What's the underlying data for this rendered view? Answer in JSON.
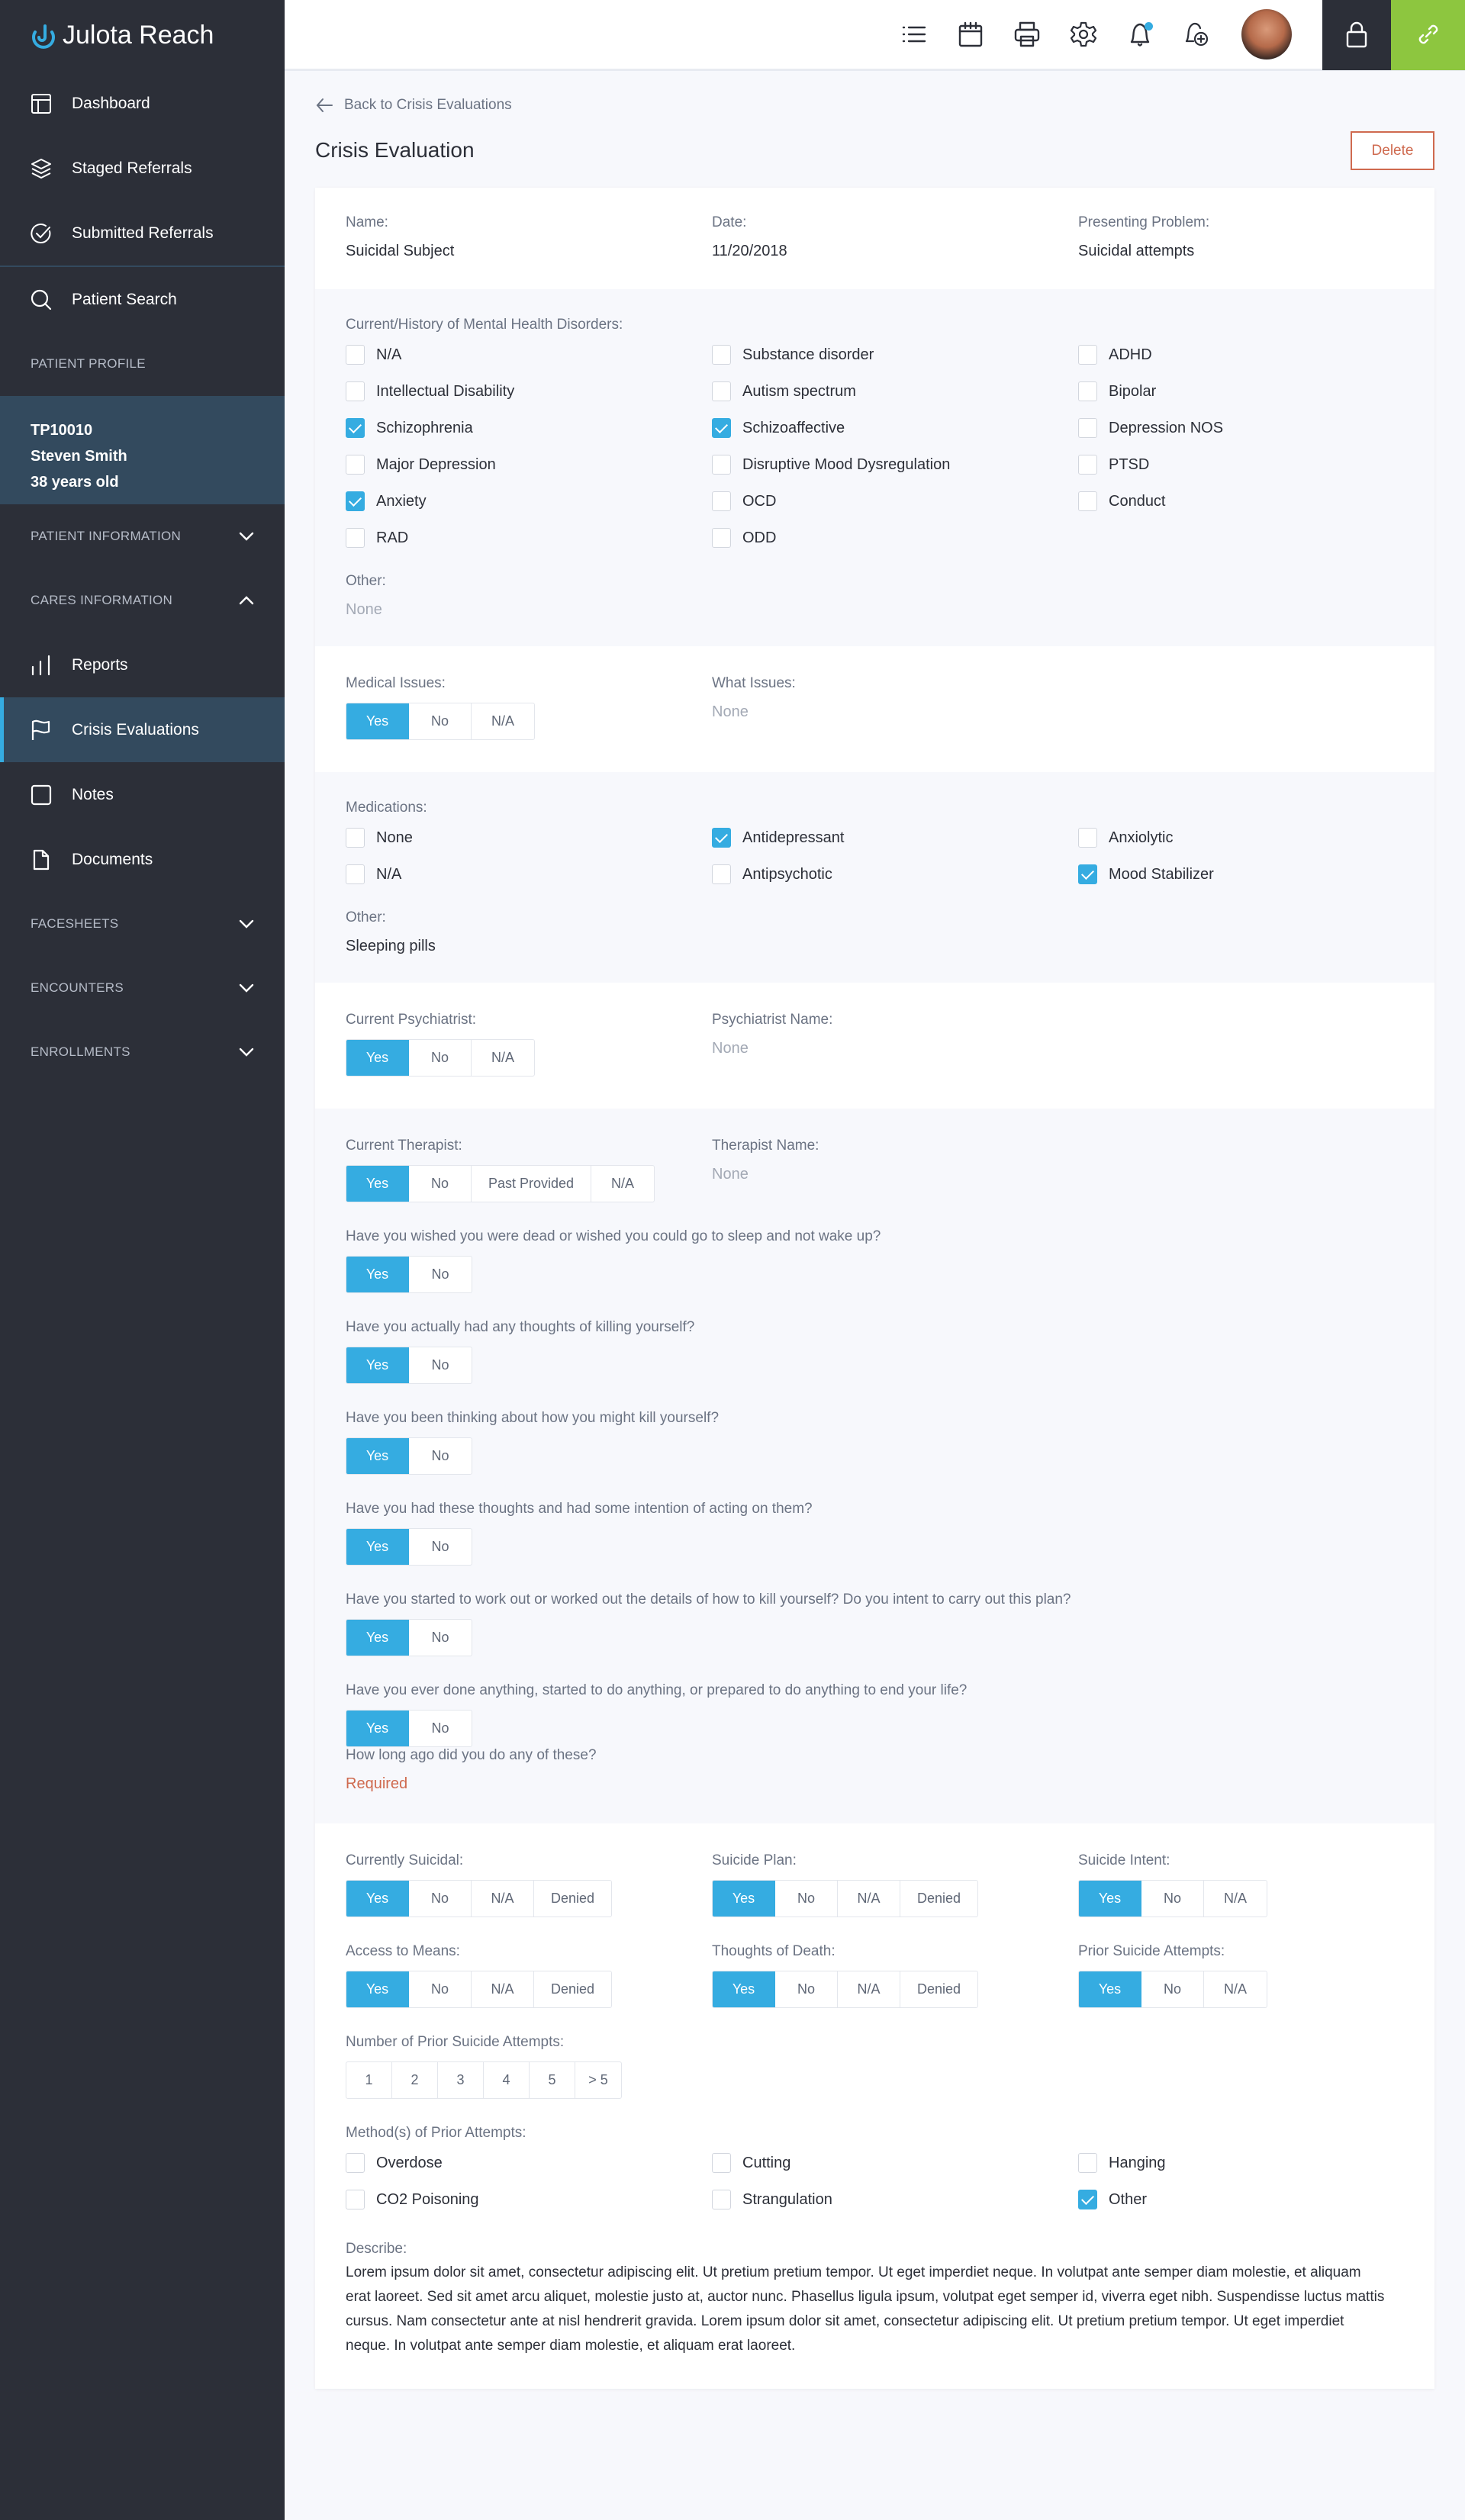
{
  "app": {
    "name": "Julota Reach"
  },
  "sidebar": {
    "nav": [
      {
        "label": "Dashboard",
        "icon": "dashboard-icon"
      },
      {
        "label": "Staged Referrals",
        "icon": "layers-icon"
      },
      {
        "label": "Submitted Referrals",
        "icon": "check-circle-icon"
      },
      {
        "label": "Patient Search",
        "icon": "search-icon"
      }
    ],
    "patient_profile_heading": "PATIENT PROFILE",
    "patient": {
      "id": "TP10010",
      "name": "Steven Smith",
      "age": "38 years old"
    },
    "patient_information": "PATIENT INFORMATION",
    "cares_information": "CARES INFORMATION",
    "cares_items": [
      {
        "label": "Reports",
        "icon": "bar-chart-icon",
        "active": false
      },
      {
        "label": "Crisis Evaluations",
        "icon": "flag-icon",
        "active": true
      },
      {
        "label": "Notes",
        "icon": "square-icon",
        "active": false
      },
      {
        "label": "Documents",
        "icon": "file-icon",
        "active": false
      }
    ],
    "facesheets": "FACESHEETS",
    "encounters": "ENCOUNTERS",
    "enrollments": "ENROLLMENTS"
  },
  "topbar": {
    "icons": [
      "list-icon",
      "calendar-icon",
      "printer-icon",
      "gear-icon",
      "bell-icon",
      "bell-plus-icon"
    ],
    "has_notification": true
  },
  "page": {
    "back_label": "Back to Crisis Evaluations",
    "title": "Crisis Evaluation",
    "delete_label": "Delete"
  },
  "summary": {
    "name_label": "Name:",
    "name": "Suicidal Subject",
    "date_label": "Date:",
    "date": "11/20/2018",
    "problem_label": "Presenting Problem:",
    "problem": "Suicidal attempts"
  },
  "disorders": {
    "label": "Current/History of Mental Health Disorders:",
    "columns": [
      [
        {
          "label": "N/A",
          "checked": false
        },
        {
          "label": "Intellectual Disability",
          "checked": false
        },
        {
          "label": "Schizophrenia",
          "checked": true
        },
        {
          "label": "Major Depression",
          "checked": false
        },
        {
          "label": "Anxiety",
          "checked": true
        },
        {
          "label": "RAD",
          "checked": false
        }
      ],
      [
        {
          "label": "Substance disorder",
          "checked": false
        },
        {
          "label": "Autism spectrum",
          "checked": false
        },
        {
          "label": "Schizoaffective",
          "checked": true
        },
        {
          "label": "Disruptive Mood Dysregulation",
          "checked": false
        },
        {
          "label": "OCD",
          "checked": false
        },
        {
          "label": "ODD",
          "checked": false
        }
      ],
      [
        {
          "label": "ADHD",
          "checked": false
        },
        {
          "label": "Bipolar",
          "checked": false
        },
        {
          "label": "Depression NOS",
          "checked": false
        },
        {
          "label": "PTSD",
          "checked": false
        },
        {
          "label": "Conduct",
          "checked": false
        }
      ]
    ],
    "other_label": "Other:",
    "other_value": "None"
  },
  "medical": {
    "label": "Medical Issues:",
    "options": [
      "Yes",
      "No",
      "N/A"
    ],
    "selected": "Yes",
    "what_label": "What Issues:",
    "what_value": "None"
  },
  "medications": {
    "label": "Medications:",
    "columns": [
      [
        {
          "label": "None",
          "checked": false
        },
        {
          "label": "N/A",
          "checked": false
        }
      ],
      [
        {
          "label": "Antidepressant",
          "checked": true
        },
        {
          "label": "Antipsychotic",
          "checked": false
        }
      ],
      [
        {
          "label": "Anxiolytic",
          "checked": false
        },
        {
          "label": "Mood Stabilizer",
          "checked": true
        }
      ]
    ],
    "other_label": "Other:",
    "other_value": "Sleeping pills"
  },
  "psychiatrist": {
    "label": "Current Psychiatrist:",
    "options": [
      "Yes",
      "No",
      "N/A"
    ],
    "selected": "Yes",
    "name_label": "Psychiatrist Name:",
    "name_value": "None"
  },
  "therapist": {
    "label": "Current Therapist:",
    "options": [
      "Yes",
      "No",
      "Past Provided",
      "N/A"
    ],
    "selected": "Yes",
    "name_label": "Therapist Name:",
    "name_value": "None"
  },
  "questions": [
    {
      "text": "Have you wished you were dead or wished you could go to sleep and not wake up?",
      "options": [
        "Yes",
        "No"
      ],
      "selected": "Yes"
    },
    {
      "text": "Have you actually had any thoughts of killing yourself?",
      "options": [
        "Yes",
        "No"
      ],
      "selected": "Yes"
    },
    {
      "text": "Have you been thinking about how you might kill yourself?",
      "options": [
        "Yes",
        "No"
      ],
      "selected": "Yes"
    },
    {
      "text": "Have you had these thoughts and had some intention of acting on them?",
      "options": [
        "Yes",
        "No"
      ],
      "selected": "Yes"
    },
    {
      "text": "Have you started to work out or worked out the details of how to kill yourself? Do you intent to carry out this plan?",
      "options": [
        "Yes",
        "No"
      ],
      "selected": "Yes"
    },
    {
      "text": "Have you ever done anything, started to do anything, or prepared to do anything to end your life?",
      "options": [
        "Yes",
        "No"
      ],
      "selected": "Yes"
    }
  ],
  "how_long": {
    "label": "How long ago did you do any of these?",
    "value": "Required"
  },
  "risk": {
    "row1": [
      {
        "label": "Currently Suicidal:",
        "options": [
          "Yes",
          "No",
          "N/A",
          "Denied"
        ],
        "selected": "Yes"
      },
      {
        "label": "Suicide Plan:",
        "options": [
          "Yes",
          "No",
          "N/A",
          "Denied"
        ],
        "selected": "Yes"
      },
      {
        "label": "Suicide Intent:",
        "options": [
          "Yes",
          "No",
          "N/A"
        ],
        "selected": "Yes"
      }
    ],
    "row2": [
      {
        "label": "Access to Means:",
        "options": [
          "Yes",
          "No",
          "N/A",
          "Denied"
        ],
        "selected": "Yes"
      },
      {
        "label": "Thoughts of Death:",
        "options": [
          "Yes",
          "No",
          "N/A",
          "Denied"
        ],
        "selected": "Yes"
      },
      {
        "label": "Prior Suicide Attempts:",
        "options": [
          "Yes",
          "No",
          "N/A"
        ],
        "selected": "Yes"
      }
    ],
    "num_attempts_label": "Number of Prior Suicide Attempts:",
    "num_attempts_options": [
      "1",
      "2",
      "3",
      "4",
      "5",
      "> 5"
    ],
    "num_attempts_selected": null,
    "methods_label": "Method(s) of Prior Attempts:",
    "methods_columns": [
      [
        {
          "label": "Overdose",
          "checked": false
        },
        {
          "label": "CO2 Poisoning",
          "checked": false
        }
      ],
      [
        {
          "label": "Cutting",
          "checked": false
        },
        {
          "label": "Strangulation",
          "checked": false
        }
      ],
      [
        {
          "label": "Hanging",
          "checked": false
        },
        {
          "label": "Other",
          "checked": true
        }
      ]
    ],
    "describe_label": "Describe:",
    "describe_text": "Lorem ipsum dolor sit amet, consectetur adipiscing elit. Ut pretium pretium tempor. Ut eget imperdiet neque. In volutpat ante semper diam molestie, et aliquam erat laoreet. Sed sit amet arcu aliquet, molestie justo at, auctor nunc. Phasellus ligula ipsum, volutpat eget semper id, viverra eget nibh. Suspendisse luctus mattis cursus. Nam consectetur ante at nisl hendrerit gravida. Lorem ipsum dolor sit amet, consectetur adipiscing elit. Ut pretium pretium tempor. Ut eget imperdiet neque. In volutpat ante semper diam molestie, et aliquam erat laoreet."
  },
  "colors": {
    "accent": "#35ace1",
    "sidebar": "#2c2f38",
    "sidebar_active": "#334a5e",
    "link_button": "#8dc63f",
    "danger": "#cf6a4f"
  }
}
